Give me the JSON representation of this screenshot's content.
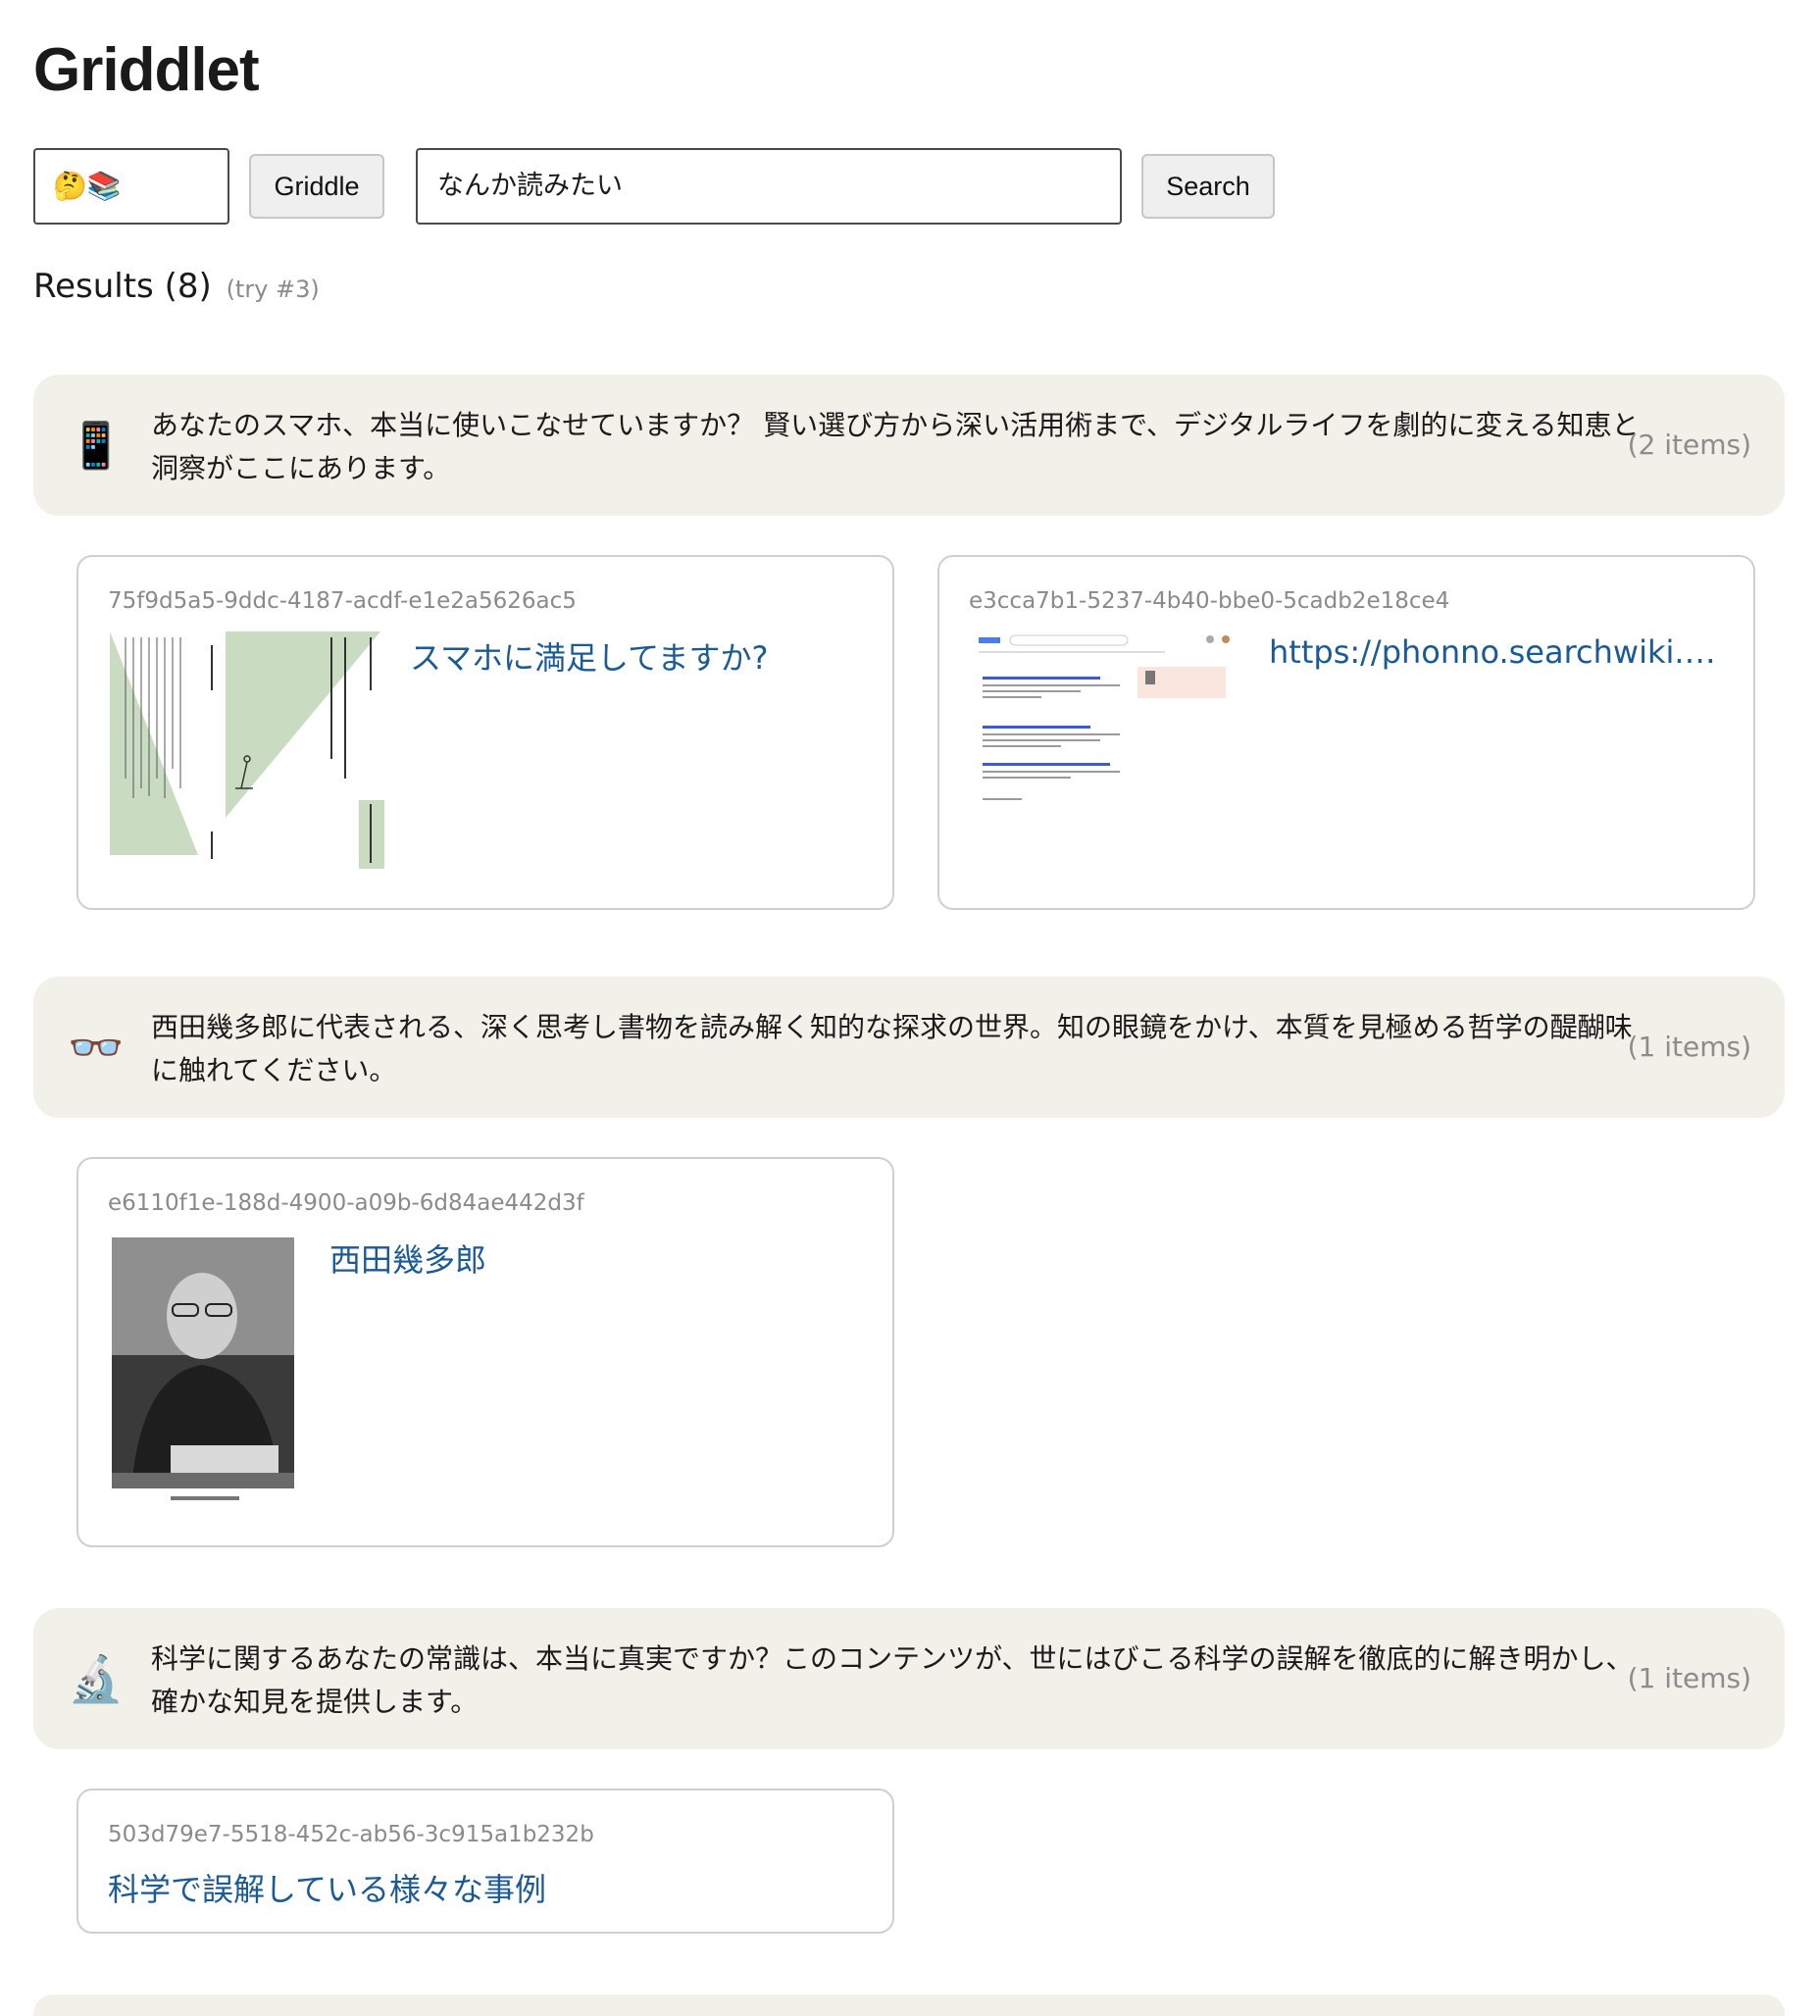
{
  "app": {
    "title": "Griddlet"
  },
  "toolbar": {
    "emoji_value": "🤔📚",
    "griddle_label": "Griddle",
    "query_value": "なんか読みたい",
    "search_label": "Search"
  },
  "results": {
    "label": "Results (8)",
    "try_label": "(try #3)"
  },
  "groups": [
    {
      "icon": "📱",
      "text": "あなたのスマホ、本当に使いこなせていますか？ 賢い選び方から深い活用術まで、デジタルライフを劇的に変える知恵と洞察がここにあります。",
      "count": "(2 items)",
      "cards": [
        {
          "id": "75f9d5a5-9ddc-4187-acdf-e1e2a5626ac5",
          "title": "スマホに満足してますか?"
        },
        {
          "id": "e3cca7b1-5237-4b40-bbe0-5cadb2e18ce4",
          "title": "https://phonno.searchwiki.org/"
        }
      ]
    },
    {
      "icon": "👓",
      "text": "西田幾多郎に代表される、深く思考し書物を読み解く知的な探求の世界。知の眼鏡をかけ、本質を見極める哲学の醍醐味に触れてください。",
      "count": "(1 items)",
      "cards": [
        {
          "id": "e6110f1e-188d-4900-a09b-6d84ae442d3f",
          "title": "西田幾多郎"
        }
      ]
    },
    {
      "icon": "🔬",
      "text": "科学に関するあなたの常識は、本当に真実ですか？このコンテンツが、世にはびこる科学の誤解を徹底的に解き明かし、確かな知見を提供します。",
      "count": "(1 items)",
      "cards": [
        {
          "id": "503d79e7-5518-452c-ab56-3c915a1b232b",
          "title": "科学で誤解している様々な事例"
        }
      ]
    }
  ],
  "colors": {
    "banner_bg": "#f1f0e9",
    "link": "#1a5a96",
    "muted": "#8a8a8a",
    "cover_green": "#c9dcc2"
  }
}
